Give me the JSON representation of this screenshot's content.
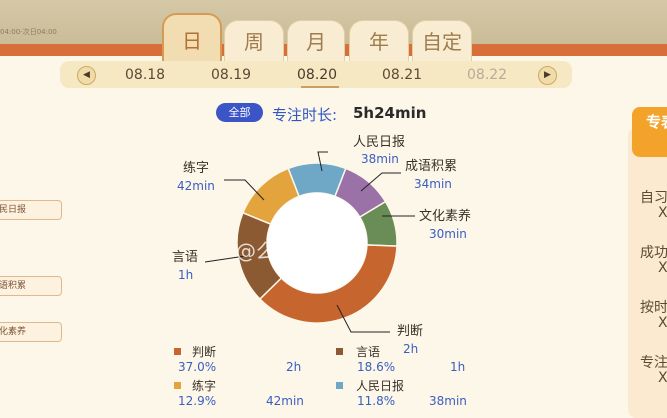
{
  "top_time": "04:00-次日04:00",
  "tabs": [
    {
      "label": "日"
    },
    {
      "label": "周"
    },
    {
      "label": "月"
    },
    {
      "label": "年"
    },
    {
      "label": "自定"
    }
  ],
  "dates": [
    "08.18",
    "08.19",
    "08.20",
    "08.21",
    "08.22"
  ],
  "summary": {
    "badge": "全部",
    "label": "专注时长:",
    "value": "5h24min"
  },
  "colors": {
    "accent": "#3b55c6",
    "tab_active": "#f1ddb1",
    "brand_orange": "#d86f3a"
  },
  "chart_data": {
    "type": "pie",
    "slices": [
      {
        "name": "判断",
        "value": 120,
        "percent": "37.0%",
        "duration": "2h",
        "color": "#c7652f"
      },
      {
        "name": "言语",
        "value": 60,
        "percent": "18.6%",
        "duration": "1h",
        "color": "#8b5a33"
      },
      {
        "name": "练字",
        "value": 42,
        "percent": "12.9%",
        "duration": "42min",
        "color": "#e3a33d"
      },
      {
        "name": "人民日报",
        "value": 38,
        "percent": "11.8%",
        "duration": "38min",
        "color": "#6fa8c6"
      },
      {
        "name": "成语积累",
        "value": 34,
        "percent": "",
        "duration": "34min",
        "color": "#9b72a8"
      },
      {
        "name": "文化素养",
        "value": 30,
        "percent": "",
        "duration": "30min",
        "color": "#6a8d57"
      }
    ]
  },
  "left_list": [
    "民日报",
    "语积累",
    "化素养"
  ],
  "right_panel": {
    "header": "专表",
    "items": [
      {
        "name": "自习",
        "mark": "X"
      },
      {
        "name": "成功",
        "mark": "X"
      },
      {
        "name": "按时",
        "mark": "X"
      },
      {
        "name": "专注",
        "mark": "X"
      }
    ]
  },
  "watermark": "@么   成公"
}
